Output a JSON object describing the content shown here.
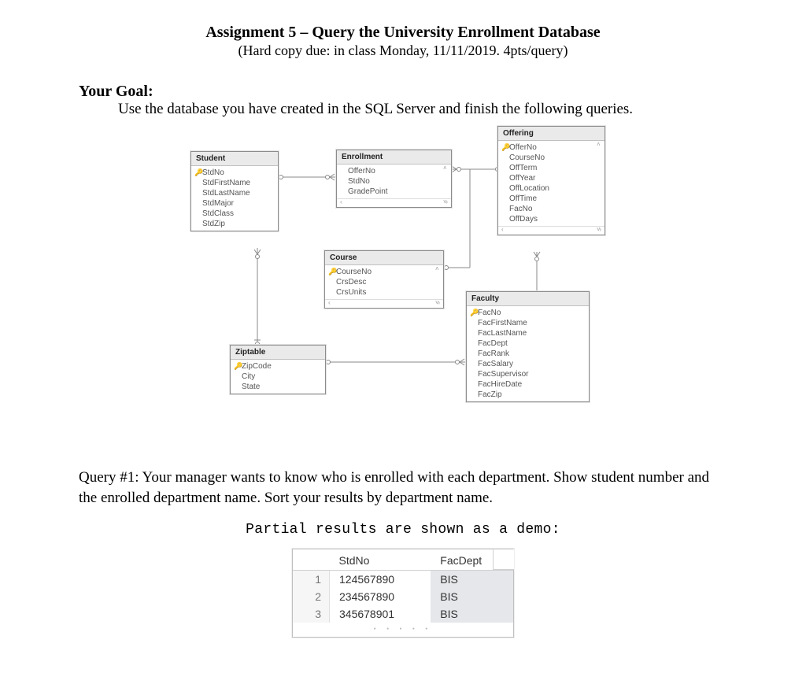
{
  "doc": {
    "title_prefix": "Assignment 5 – ",
    "title_main": "Query the University Enrollment Database",
    "subtitle": "(Hard copy due: in class Monday, 11/11/2019. 4pts/query)",
    "goal_label": "Your Goal:",
    "goal_text": "Use the database you have created in the SQL Server and finish the following queries."
  },
  "erd": {
    "entities": {
      "Student": {
        "title": "Student",
        "pk": "StdNo",
        "fields": [
          "StdFirstName",
          "StdLastName",
          "StdMajor",
          "StdClass",
          "StdZip"
        ]
      },
      "Enrollment": {
        "title": "Enrollment",
        "pk": null,
        "fields": [
          "OfferNo",
          "StdNo",
          "GradePoint"
        ]
      },
      "Offering": {
        "title": "Offering",
        "pk": "OfferNo",
        "fields": [
          "CourseNo",
          "OffTerm",
          "OffYear",
          "OffLocation",
          "OffTime",
          "FacNo",
          "OffDays"
        ]
      },
      "Course": {
        "title": "Course",
        "pk": "CourseNo",
        "fields": [
          "CrsDesc",
          "CrsUnits"
        ]
      },
      "Ziptable": {
        "title": "Ziptable",
        "pk": "ZipCode",
        "fields": [
          "City",
          "State"
        ]
      },
      "Faculty": {
        "title": "Faculty",
        "pk": "FacNo",
        "fields": [
          "FacFirstName",
          "FacLastName",
          "FacDept",
          "FacRank",
          "FacSalary",
          "FacSupervisor",
          "FacHireDate",
          "FacZip"
        ]
      }
    }
  },
  "query1": {
    "text": "Query #1: Your manager wants to know who is enrolled with each department. Show student number and the enrolled department name. Sort your results by department name.",
    "demo_label": "Partial results are shown as a demo:",
    "table": {
      "headers": {
        "rownum": "",
        "col1": "StdNo",
        "col2": "FacDept"
      },
      "rows": [
        {
          "n": "1",
          "stdno": "124567890",
          "dept": "BIS"
        },
        {
          "n": "2",
          "stdno": "234567890",
          "dept": "BIS"
        },
        {
          "n": "3",
          "stdno": "345678901",
          "dept": "BIS"
        }
      ]
    }
  }
}
